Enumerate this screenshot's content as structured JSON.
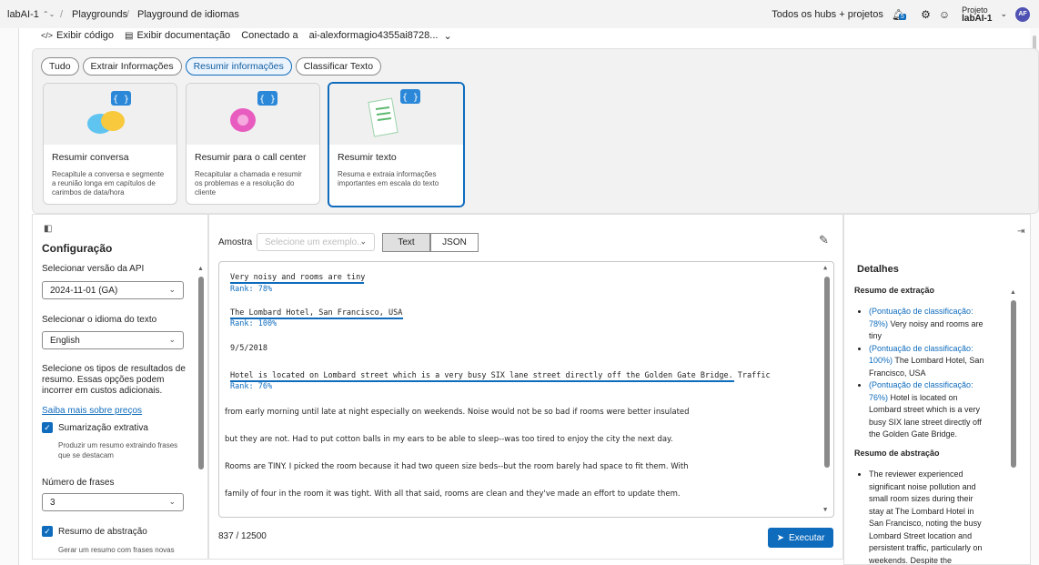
{
  "topbar": {
    "project": "labAI-1",
    "breadcrumb_1": "Playgrounds",
    "breadcrumb_2": "Playground de idiomas",
    "hubs": "Todos os hubs + projetos",
    "badge": "5",
    "project_label": "Projeto",
    "project_name": "labAI-1",
    "avatar": "AF"
  },
  "toolbar": {
    "show_code": "Exibir código",
    "show_docs": "Exibir documentação",
    "connected_label": "Conectado a",
    "connected_resource": "ai-alexformagio4355ai8728..."
  },
  "filters": [
    "Tudo",
    "Extrair Informações",
    "Resumir informações",
    "Classificar Texto"
  ],
  "active_filter": 2,
  "cards": [
    {
      "title": "Resumir conversa",
      "desc": "Recapitule a conversa e segmente a reunião longa em capítulos de carimbos de data/hora"
    },
    {
      "title": "Resumir para o call center",
      "desc": "Recapitular a chamada e resumir os problemas e a resolução do cliente"
    },
    {
      "title": "Resumir texto",
      "desc": "Resuma e extraia informações importantes em escala do texto"
    }
  ],
  "config": {
    "title": "Configuração",
    "api_label": "Selecionar versão da API",
    "api_value": "2024-11-01 (GA)",
    "lang_label": "Selecionar o idioma do texto",
    "lang_value": "English",
    "types_desc": "Selecione os tipos de resultados de resumo. Essas opções podem incorrer em custos adicionais.",
    "learn_more": "Saiba mais sobre preços",
    "extractive_label": "Sumarização extrativa",
    "extractive_desc": "Produzir um resumo extraindo frases que se destacam",
    "sentences_label": "Número de frases",
    "sentences_value": "3",
    "abstractive_label": "Resumo de abstração",
    "abstractive_desc": "Gerar um resumo com frases novas"
  },
  "center": {
    "sample_label": "Amostra",
    "sample_placeholder": "Selecione um exemplo...",
    "tab_text": "Text",
    "tab_json": "JSON",
    "count": "837 / 12500",
    "run": "Executar"
  },
  "text": {
    "l1": "Very noisy and rooms are tiny",
    "r1": "Rank: 78%",
    "l2": "The Lombard Hotel, San Francisco, USA",
    "r2": "Rank: 100%",
    "l3": "9/5/2018",
    "l4": "Hotel is located on Lombard street which is a very busy SIX lane street directly off the Golden Gate Bridge.",
    "l4b": " Traffic",
    "r4": "Rank: 76%",
    "l5": "from early morning until late at night especially on weekends. Noise would not be so bad if rooms were better insulated",
    "l6": "but they are not. Had to put cotton balls in my ears to be able to sleep--was too tired to enjoy the city the next day.",
    "l7": "Rooms are TINY. I picked the room because it had two queen size beds--but the room barely had space to fit them. With",
    "l8": "family of four in the room it was tight. With all that said, rooms are clean and they've made an effort to update them."
  },
  "details": {
    "title": "Detalhes",
    "extract_title": "Resumo de extração",
    "items": [
      {
        "rank": "(Pontuação de classificação: 78%)",
        "text": " Very noisy and rooms are tiny"
      },
      {
        "rank": "(Pontuação de classificação: 100%)",
        "text": " The Lombard Hotel, San Francisco, USA"
      },
      {
        "rank": "(Pontuação de classificação: 76%)",
        "text": " Hotel is located on Lombard street which is a very busy SIX lane street directly off the Golden Gate Bridge."
      }
    ],
    "abstract_title": "Resumo de abstração",
    "abstract_text": "The reviewer experienced significant noise pollution and small room sizes during their stay at The Lombard Hotel in San Francisco, noting the busy Lombard Street location and persistent traffic, particularly on weekends. Despite the"
  }
}
